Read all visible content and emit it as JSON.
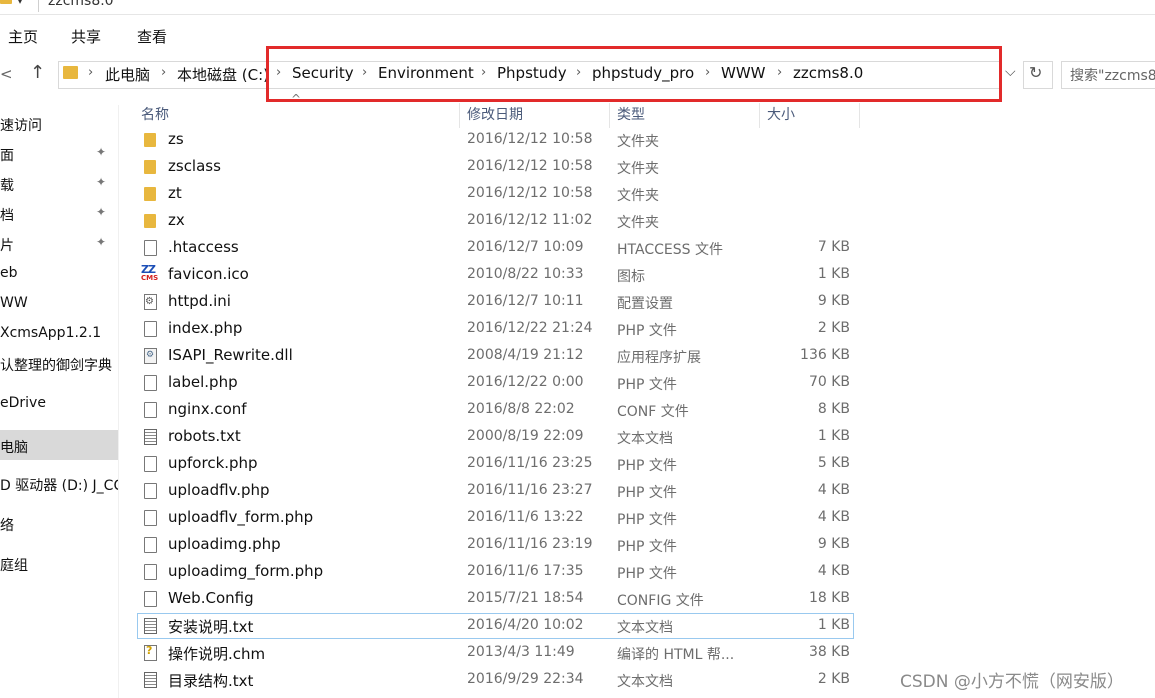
{
  "window": {
    "title": "zzcms8.0"
  },
  "ribbon": {
    "tabs": [
      "主页",
      "共享",
      "查看"
    ]
  },
  "address": {
    "crumbs": [
      "此电脑",
      "本地磁盘 (C:)",
      "Security",
      "Environment",
      "Phpstudy",
      "phpstudy_pro",
      "WWW",
      "zzcms8.0"
    ],
    "highlight_color": "#e22a2a"
  },
  "search": {
    "placeholder": "搜索\"zzcms8"
  },
  "nav_pane": {
    "items": [
      "速访问",
      "面",
      "载",
      "档",
      "片",
      "eb",
      "WW",
      "XcmsApp1.2.1",
      "认整理的御剑字典",
      "eDrive",
      "电脑",
      "D 驱动器 (D:) J_CC",
      "络",
      "庭组"
    ],
    "selected": "电脑"
  },
  "columns": {
    "name": "名称",
    "date": "修改日期",
    "type": "类型",
    "size": "大小"
  },
  "files": [
    {
      "icon": "folder-icon",
      "name": "zs",
      "date": "2016/12/12 10:58",
      "type": "文件夹",
      "size": ""
    },
    {
      "icon": "folder-icon",
      "name": "zsclass",
      "date": "2016/12/12 10:58",
      "type": "文件夹",
      "size": ""
    },
    {
      "icon": "folder-icon",
      "name": "zt",
      "date": "2016/12/12 10:58",
      "type": "文件夹",
      "size": ""
    },
    {
      "icon": "folder-icon",
      "name": "zx",
      "date": "2016/12/12 11:02",
      "type": "文件夹",
      "size": ""
    },
    {
      "icon": "file-icon",
      "name": ".htaccess",
      "date": "2016/12/7 10:09",
      "type": "HTACCESS 文件",
      "size": "7 KB"
    },
    {
      "icon": "zzcms-favicon-icon",
      "name": "favicon.ico",
      "date": "2010/8/22 10:33",
      "type": "图标",
      "size": "1 KB"
    },
    {
      "icon": "settings-file-icon",
      "name": "httpd.ini",
      "date": "2016/12/7 10:11",
      "type": "配置设置",
      "size": "9 KB"
    },
    {
      "icon": "file-icon",
      "name": "index.php",
      "date": "2016/12/22 21:24",
      "type": "PHP 文件",
      "size": "2 KB"
    },
    {
      "icon": "dll-icon",
      "name": "ISAPI_Rewrite.dll",
      "date": "2008/4/19 21:12",
      "type": "应用程序扩展",
      "size": "136 KB"
    },
    {
      "icon": "file-icon",
      "name": "label.php",
      "date": "2016/12/22 0:00",
      "type": "PHP 文件",
      "size": "70 KB"
    },
    {
      "icon": "file-icon",
      "name": "nginx.conf",
      "date": "2016/8/8 22:02",
      "type": "CONF 文件",
      "size": "8 KB"
    },
    {
      "icon": "text-file-icon",
      "name": "robots.txt",
      "date": "2000/8/19 22:09",
      "type": "文本文档",
      "size": "1 KB"
    },
    {
      "icon": "file-icon",
      "name": "upforck.php",
      "date": "2016/11/16 23:25",
      "type": "PHP 文件",
      "size": "5 KB"
    },
    {
      "icon": "file-icon",
      "name": "uploadflv.php",
      "date": "2016/11/16 23:27",
      "type": "PHP 文件",
      "size": "4 KB"
    },
    {
      "icon": "file-icon",
      "name": "uploadflv_form.php",
      "date": "2016/11/6 13:22",
      "type": "PHP 文件",
      "size": "4 KB"
    },
    {
      "icon": "file-icon",
      "name": "uploadimg.php",
      "date": "2016/11/16 23:19",
      "type": "PHP 文件",
      "size": "9 KB"
    },
    {
      "icon": "file-icon",
      "name": "uploadimg_form.php",
      "date": "2016/11/6 17:35",
      "type": "PHP 文件",
      "size": "4 KB"
    },
    {
      "icon": "file-icon",
      "name": "Web.Config",
      "date": "2015/7/21 18:54",
      "type": "CONFIG 文件",
      "size": "18 KB"
    },
    {
      "icon": "text-file-icon",
      "name": "安装说明.txt",
      "date": "2016/4/20 10:02",
      "type": "文本文档",
      "size": "1 KB"
    },
    {
      "icon": "help-file-icon",
      "name": "操作说明.chm",
      "date": "2013/4/3 11:49",
      "type": "编译的 HTML 帮...",
      "size": "38 KB"
    },
    {
      "icon": "text-file-icon",
      "name": "目录结构.txt",
      "date": "2016/9/29 22:34",
      "type": "文本文档",
      "size": "2 KB"
    }
  ],
  "watermark": "CSDN @小方不慌（网安版）"
}
